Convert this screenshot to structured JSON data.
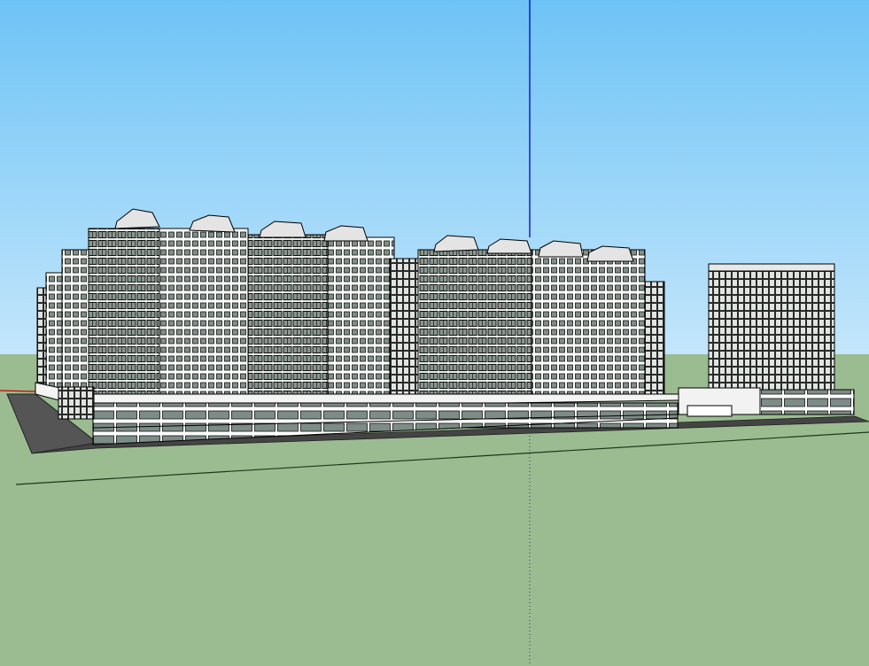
{
  "viewport": {
    "sky_top_color": "#6ec3f6",
    "sky_bottom_color": "#c4e6fb",
    "ground_color": "#9bbc91",
    "horizon_line_color": "#5a6a5a",
    "building_glass_color": "#7f8f88",
    "building_frame_color": "#111111",
    "building_wall_color": "#ffffff",
    "podium_color": "#e6ebe6",
    "road_color": "#555555",
    "blue_axis_color": "#0000cc",
    "red_axis_color": "#cc0000",
    "green_axis_color": "#1a6a1a"
  },
  "scene": {
    "description_icon": "3d-model-icon",
    "objects": [
      "left-tower-block",
      "center-tower-block",
      "right-tower-block",
      "podium",
      "road",
      "axes"
    ]
  }
}
